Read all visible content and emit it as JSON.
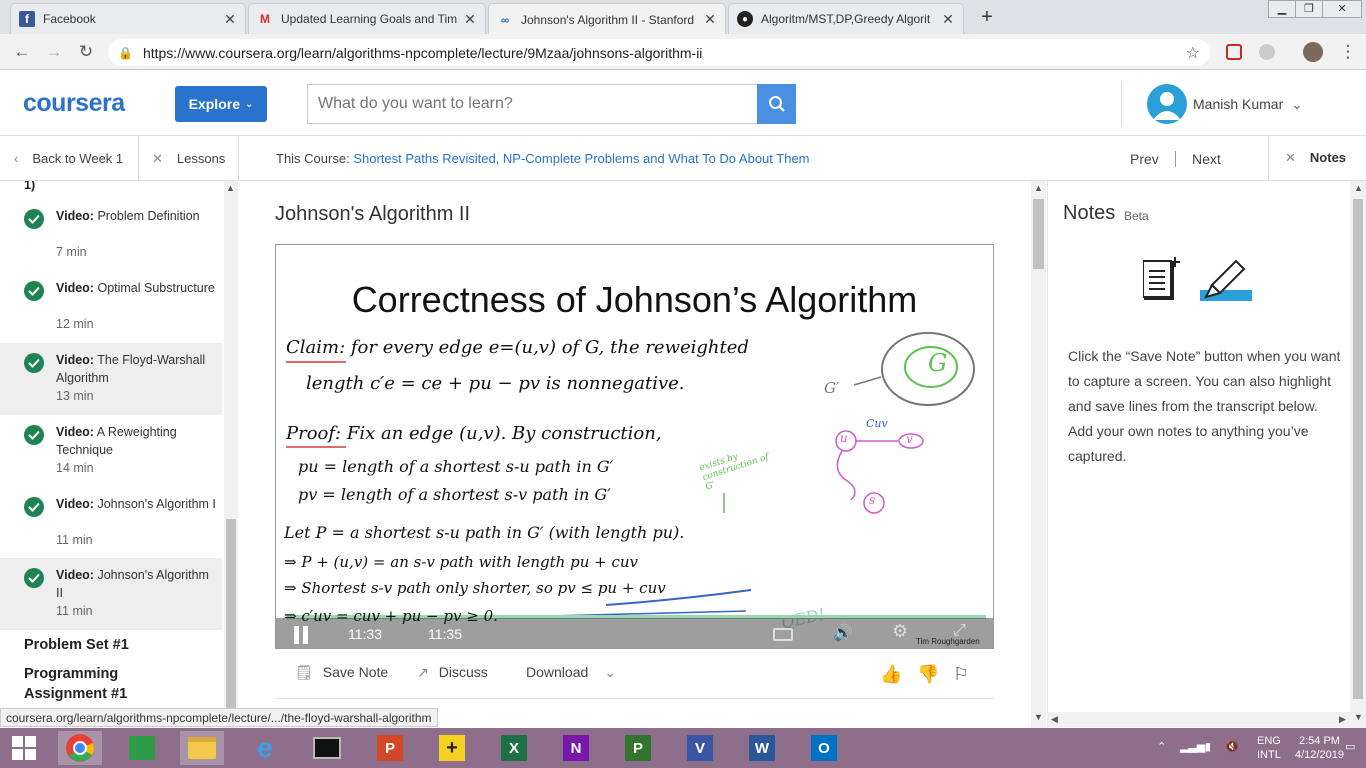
{
  "browser": {
    "tabs": [
      {
        "title": "Facebook",
        "icon": "facebook-icon",
        "color": "#3b5998"
      },
      {
        "title": "Updated Learning Goals and Tim",
        "icon": "gmail-icon",
        "color": "#d93025"
      },
      {
        "title": "Johnson's Algorithm II - Stanford",
        "icon": "coursera-icon",
        "color": "#2a73cc"
      },
      {
        "title": "Algoritm/MST,DP,Greedy Algorit",
        "icon": "github-icon",
        "color": "#222222"
      }
    ],
    "url": "https://www.coursera.org/learn/algorithms-npcomplete/lecture/9Mzaa/johnsons-algorithm-ii",
    "status_url": "coursera.org/learn/algorithms-npcomplete/lecture/.../the-floyd-warshall-algorithm"
  },
  "header": {
    "logo": "coursera",
    "explore": "Explore",
    "search_placeholder": "What do you want to learn?",
    "user_name": "Manish Kumar"
  },
  "subnav": {
    "back": "Back to Week 1",
    "lessons": "Lessons",
    "course_prefix": "This Course:",
    "course_name": "Shortest Paths Revisited, NP-Complete Problems and What To Do About Them",
    "prev": "Prev",
    "next": "Next",
    "notes": "Notes"
  },
  "sidebar": {
    "partial_label": "1)",
    "items": [
      {
        "kind": "Video:",
        "title": "Problem Definition",
        "duration": "7 min",
        "highlight": false
      },
      {
        "kind": "Video:",
        "title": "Optimal Substructure",
        "duration": "12 min",
        "highlight": false
      },
      {
        "kind": "Video:",
        "title": "The Floyd-Warshall Algorithm",
        "duration": "13 min",
        "highlight": true
      },
      {
        "kind": "Video:",
        "title": "A Reweighting Technique",
        "duration": "14 min",
        "highlight": false
      },
      {
        "kind": "Video:",
        "title": "Johnson's Algorithm I",
        "duration": "11 min",
        "highlight": false
      },
      {
        "kind": "Video:",
        "title": "Johnson's Algorithm II",
        "duration": "11 min",
        "highlight": true
      }
    ],
    "sections": [
      "Problem Set #1",
      "Programming Assignment #1"
    ]
  },
  "main": {
    "title": "Johnson's Algorithm II",
    "slide": {
      "title": "Correctness of Johnson’s Algorithm",
      "lines": [
        "Claim: for every edge e=(u,v) of G, the reweighted",
        "length c′e = ce + pu − pv is nonnegative.",
        "Proof: Fix an edge (u,v). By construction,",
        "pu = length of a shortest s-u path in G′",
        "pv = length of a shortest s-v path in G′",
        "Let P = a shortest s-u path in G′ (with length pu).",
        "⇒ P + (u,v) = an s-v path with length pu + cuv",
        "⇒ Shortest s-v path only shorter, so pv ≤ pu + cuv",
        "⇒ c′uv = cuv + pu − pv ≥ 0."
      ],
      "side_note": "exists by construction of G′",
      "g_prime": "G′",
      "g_label": "G",
      "node_u": "u",
      "node_v": "v",
      "node_s": "s",
      "cuv": "Cuv",
      "qed": "QED!",
      "credit": "Tim Roughgarden"
    },
    "player": {
      "current_time": "11:33",
      "duration": "11:35",
      "progress": 0.997
    },
    "actions": {
      "save_note": "Save Note",
      "discuss": "Discuss",
      "download": "Download"
    }
  },
  "notes": {
    "title": "Notes",
    "beta": "Beta",
    "help": "Click the “Save Note” button when you want to capture a screen. You can also highlight and save lines from the transcript below. Add your own notes to anything you’ve captured."
  },
  "taskbar": {
    "lang_top": "ENG",
    "lang_bottom": "INTL",
    "time": "2:54 PM",
    "date": "4/12/2019"
  }
}
